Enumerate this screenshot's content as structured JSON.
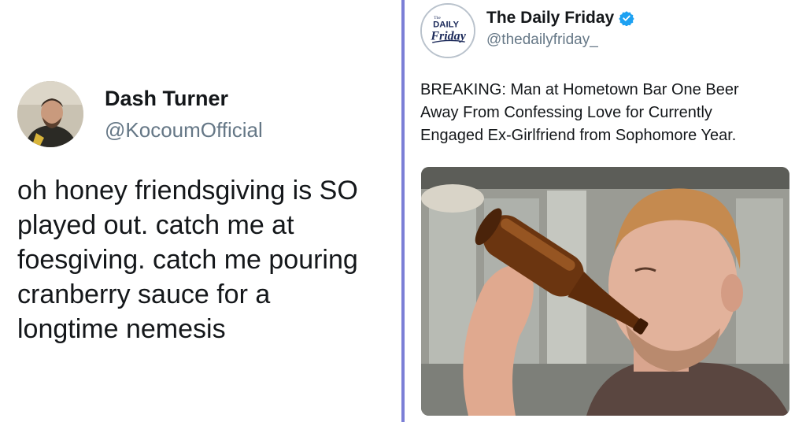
{
  "left_tweet": {
    "display_name": "Dash Turner",
    "handle": "@KocoumOfficial",
    "text_lines": [
      "oh honey friendsgiving is SO",
      "played out. catch me at",
      "foesgiving. catch me pouring",
      "cranberry sauce for a",
      "longtime nemesis"
    ]
  },
  "right_tweet": {
    "display_name": "The Daily Friday",
    "handle": "@thedailyfriday_",
    "verified": true,
    "logo_text": [
      "The",
      "DAILY",
      "Friday"
    ],
    "text_lines": [
      "BREAKING: Man at Hometown Bar One Beer",
      "Away From Confessing Love for Currently",
      "Engaged Ex-Girlfriend from Sophomore Year."
    ],
    "media_description": "man-drinking-beer-photo"
  },
  "colors": {
    "divider": "#7b7fd6",
    "handle_gray": "#657786",
    "verified_blue": "#1da1f2",
    "logo_navy": "#1c2a5a"
  }
}
